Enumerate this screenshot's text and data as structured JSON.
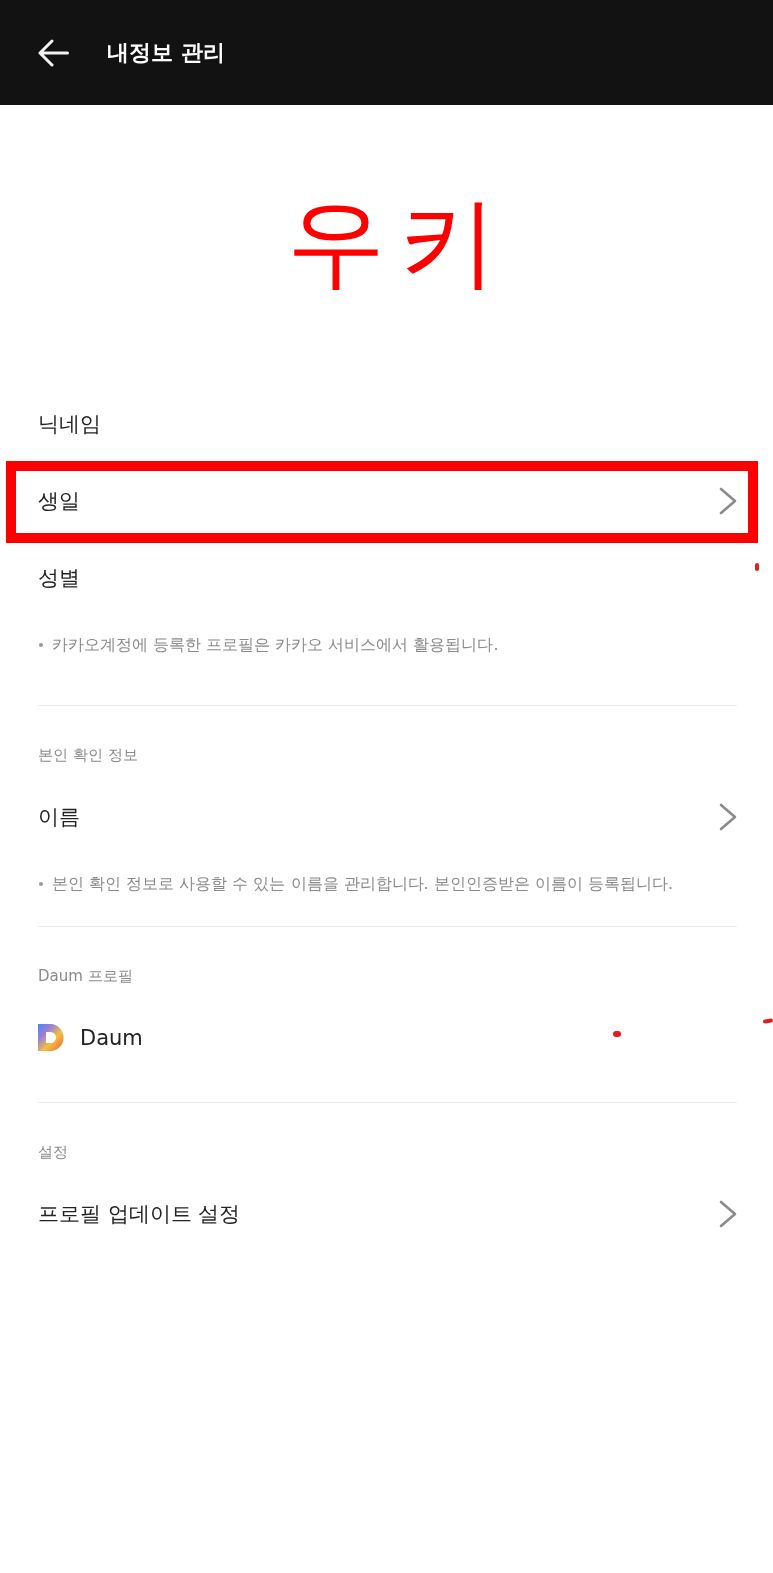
{
  "header": {
    "title": "내정보 관리"
  },
  "caption": {
    "text": "우키"
  },
  "sections": [
    {
      "items": [
        {
          "label": "닉네임",
          "kind": "text",
          "chevron": false,
          "highlighted": false
        },
        {
          "label": "생일",
          "kind": "text",
          "chevron": true,
          "highlighted": true
        },
        {
          "label": "성별",
          "kind": "text",
          "chevron": false,
          "highlighted": false
        }
      ],
      "note": "카카오계정에 등록한 프로필은 카카오 서비스에서 활용됩니다."
    },
    {
      "heading": "본인 확인 정보",
      "items": [
        {
          "label": "이름",
          "kind": "text",
          "chevron": true,
          "highlighted": false
        }
      ],
      "note": "본인 확인 정보로 사용할 수 있는 이름을 관리합니다. 본인인증받은 이름이 등록됩니다."
    },
    {
      "heading": "Daum 프로필",
      "items": [
        {
          "label": "Daum",
          "kind": "logo",
          "chevron": false,
          "highlighted": false
        }
      ]
    },
    {
      "heading": "설정",
      "items": [
        {
          "label": "프로필 업데이트 설정",
          "kind": "text",
          "chevron": true,
          "highlighted": false
        }
      ]
    }
  ]
}
